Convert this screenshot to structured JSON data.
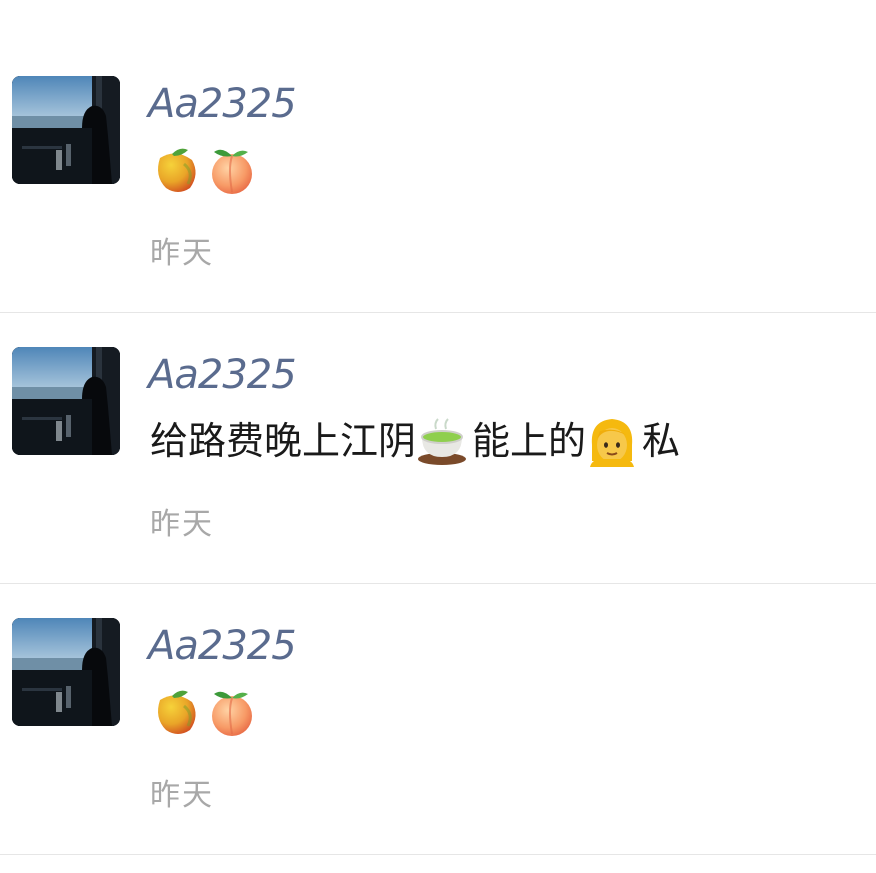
{
  "posts": [
    {
      "username": "Aa2325",
      "content": [
        {
          "type": "emoji",
          "icon": "mango-emoji"
        },
        {
          "type": "emoji",
          "icon": "peach-emoji"
        }
      ],
      "time": "昨天"
    },
    {
      "username": "Aa2325",
      "content": [
        {
          "type": "text",
          "value": "给路费晚上江阴"
        },
        {
          "type": "emoji",
          "icon": "green-tea-emoji"
        },
        {
          "type": "text",
          "value": " 能上的"
        },
        {
          "type": "emoji",
          "icon": "woman-emoji"
        },
        {
          "type": "text",
          "value": "私"
        }
      ],
      "time": "昨天"
    },
    {
      "username": "Aa2325",
      "content": [
        {
          "type": "emoji",
          "icon": "mango-emoji"
        },
        {
          "type": "emoji",
          "icon": "peach-emoji"
        }
      ],
      "time": "昨天"
    }
  ],
  "colors": {
    "username": "#5a6b8e",
    "time": "#a8a8a8",
    "divider": "#e6e6e6",
    "text": "#1a1a1a"
  }
}
